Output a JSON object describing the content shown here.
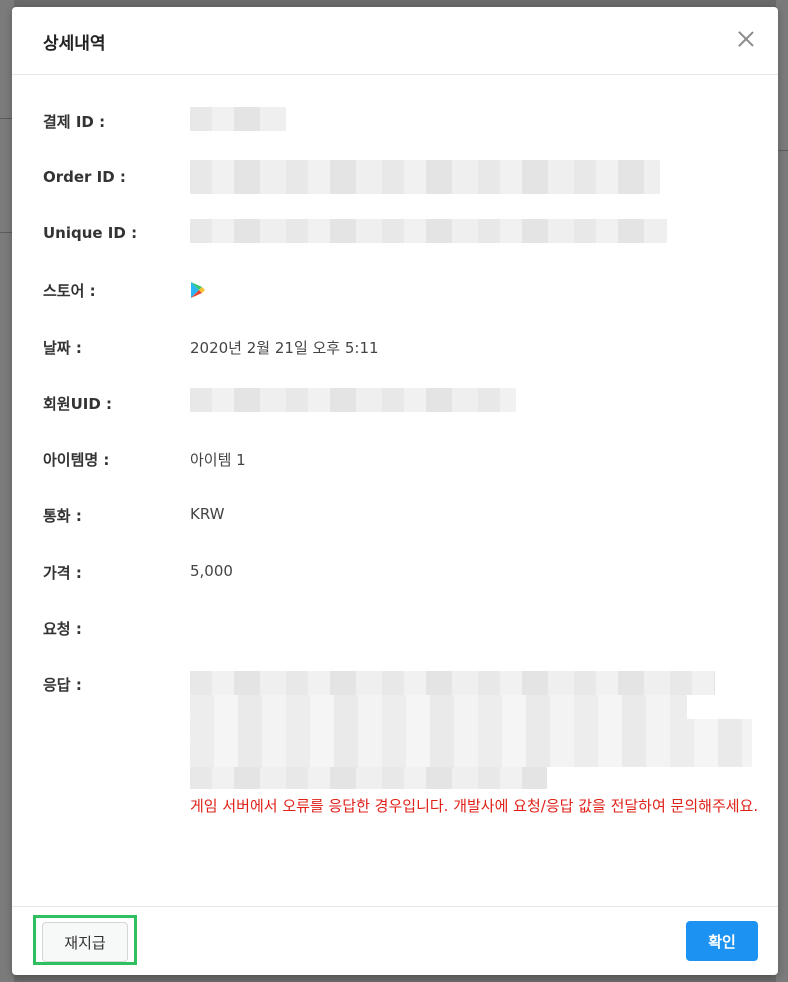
{
  "modal": {
    "title": "상세내역",
    "fields": {
      "payment_id_label": "결제 ID :",
      "order_id_label": "Order ID :",
      "unique_id_label": "Unique ID :",
      "store_label": "스토어 :",
      "store_icon": "google-play-icon",
      "date_label": "날짜 :",
      "date_value": "2020년 2월 21일 오후 5:11",
      "member_uid_label": "회원UID :",
      "item_name_label": "아이템명 :",
      "item_name_value": "아이템 1",
      "currency_label": "통화 :",
      "currency_value": "KRW",
      "price_label": "가격 :",
      "price_value": "5,000",
      "request_label": "요청 :",
      "response_label": "응답 :"
    },
    "error_message": "게임 서버에서 오류를 응답한 경우입니다. 개발사에 요청/응답 값을 전달하여 문의해주세요.",
    "footer": {
      "regrant_label": "재지급",
      "confirm_label": "확인"
    },
    "colors": {
      "error": "#e0221a",
      "confirm_button": "#1c92f3",
      "highlight": "#2ec05f"
    }
  }
}
